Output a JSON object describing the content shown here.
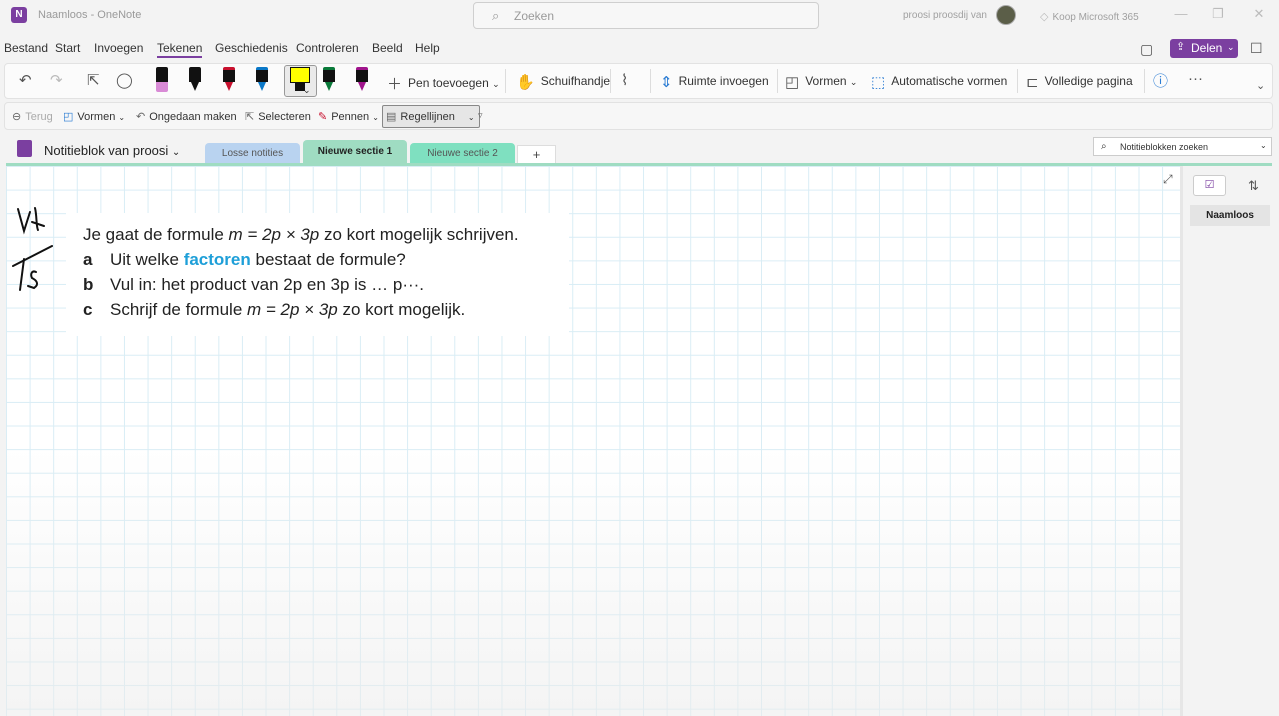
{
  "window": {
    "app_icon": "N",
    "title": "Naamloos  -  OneNote",
    "search_placeholder": "Zoeken",
    "user_name": "proosi proosdij van",
    "buy_label": "Koop Microsoft 365",
    "minimize": "—",
    "restore": "❐",
    "close": "✕"
  },
  "menu": {
    "items": [
      "Bestand",
      "Start",
      "Invoegen",
      "Tekenen",
      "Geschiedenis",
      "Controleren",
      "Beeld",
      "Help"
    ],
    "active": "Tekenen",
    "share_label": "Delen"
  },
  "ribbon": {
    "add_pen": "Pen toevoegen",
    "hand": "Schuifhandje",
    "insert_space": "Ruimte invoegen",
    "shapes": "Vormen",
    "auto_shapes": "Automatische vormen",
    "full_page": "Volledige pagina",
    "more": "···",
    "pens": [
      {
        "name": "pen-pink",
        "color": "#d98bd6"
      },
      {
        "name": "pen-black-1",
        "color": "#111111"
      },
      {
        "name": "pen-red",
        "color": "#c8102e"
      },
      {
        "name": "pen-blue",
        "color": "#0a78c8"
      },
      {
        "name": "highlighter-yellow",
        "color": "#ffff00"
      },
      {
        "name": "pen-green",
        "color": "#0a7a3a"
      },
      {
        "name": "pen-purple",
        "color": "#a0148c"
      }
    ]
  },
  "subribbon": {
    "back": "Terug",
    "shapes": "Vormen",
    "undo": "Ongedaan maken",
    "select": "Selecteren",
    "pens": "Pennen",
    "ruled_lines": "Regellijnen"
  },
  "notebook": {
    "title": "Notitieblok van proosi",
    "tabs": [
      {
        "label": "Losse notities",
        "color": "#b9d3f0",
        "active": false
      },
      {
        "label": "Nieuwe sectie 1",
        "color": "#9fdcc2",
        "active": true
      },
      {
        "label": "Nieuwe sectie 2",
        "color": "#7fe0c0",
        "active": false
      }
    ],
    "add_tab": "+",
    "search_placeholder": "Notitieblokken zoeken"
  },
  "exercise": {
    "intro_pre": "Je gaat de formule ",
    "intro_formula": "m = 2p × 3p",
    "intro_post": " zo kort mogelijk schrijven.",
    "a_letter": "a",
    "a_pre": "Uit welke ",
    "a_key": "factoren",
    "a_post": " bestaat de formule?",
    "b_letter": "b",
    "b_text": "Vul in: het product van 2p en 3p is … p···.",
    "c_letter": "c",
    "c_pre": "Schrijf de formule ",
    "c_formula": "m = 2p × 3p",
    "c_post": " zo kort mogelijk."
  },
  "pagelist": {
    "pages": [
      "Naamloos"
    ]
  }
}
